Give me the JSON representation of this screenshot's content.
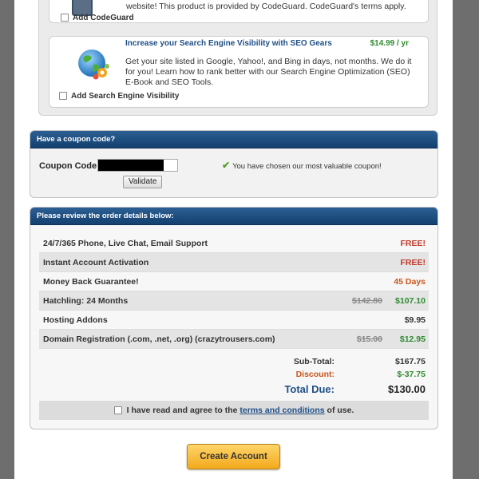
{
  "addons": {
    "codeguard": {
      "desc_tail": "website! This product is provided by CodeGuard. CodeGuard's terms apply.",
      "checkbox_label": "Add CodeGuard"
    },
    "seo": {
      "title": "Increase your Search Engine Visibility with SEO Gears",
      "price": "$14.99 / yr",
      "description": "Get your site listed in Google, Yahoo!, and Bing in days, not months. We do it for you! Learn how to rank better with our Search Engine Optimization (SEO) E-Book and SEO Tools.",
      "checkbox_label": "Add Search Engine Visibility"
    }
  },
  "coupon": {
    "header": "Have a coupon code?",
    "label": "Coupon Code",
    "validate_label": "Validate",
    "message": "You have chosen our most valuable coupon!"
  },
  "order": {
    "header": "Please review the order details below:",
    "rows": [
      {
        "label": "24/7/365 Phone, Live Chat, Email Support",
        "old": "",
        "value": "FREE!"
      },
      {
        "label": "Instant Account Activation",
        "old": "",
        "value": "FREE!"
      },
      {
        "label": "Money Back Guarantee!",
        "old": "",
        "value": "45 Days"
      },
      {
        "label": "Hatchling: 24 Months",
        "old": "$142.80",
        "value": "$107.10"
      },
      {
        "label": "Hosting Addons",
        "old": "",
        "value": "$9.95"
      },
      {
        "label": "Domain Registration (.com, .net, .org) (crazytrousers.com)",
        "old": "$15.00",
        "value": "$12.95"
      }
    ],
    "subtotal_label": "Sub-Total:",
    "subtotal_value": "$167.75",
    "discount_label": "Discount:",
    "discount_value": "$-37.75",
    "total_label": "Total Due:",
    "total_value": "$130.00",
    "agree_prefix": "I have read and agree to the",
    "agree_link": "terms and conditions",
    "agree_suffix": "of use."
  },
  "create_account_label": "Create Account",
  "colors": {
    "header_blue": "#13406f",
    "free_red": "#c0392b",
    "price_green": "#2e8b2e",
    "button_orange": "#f3a91c"
  }
}
